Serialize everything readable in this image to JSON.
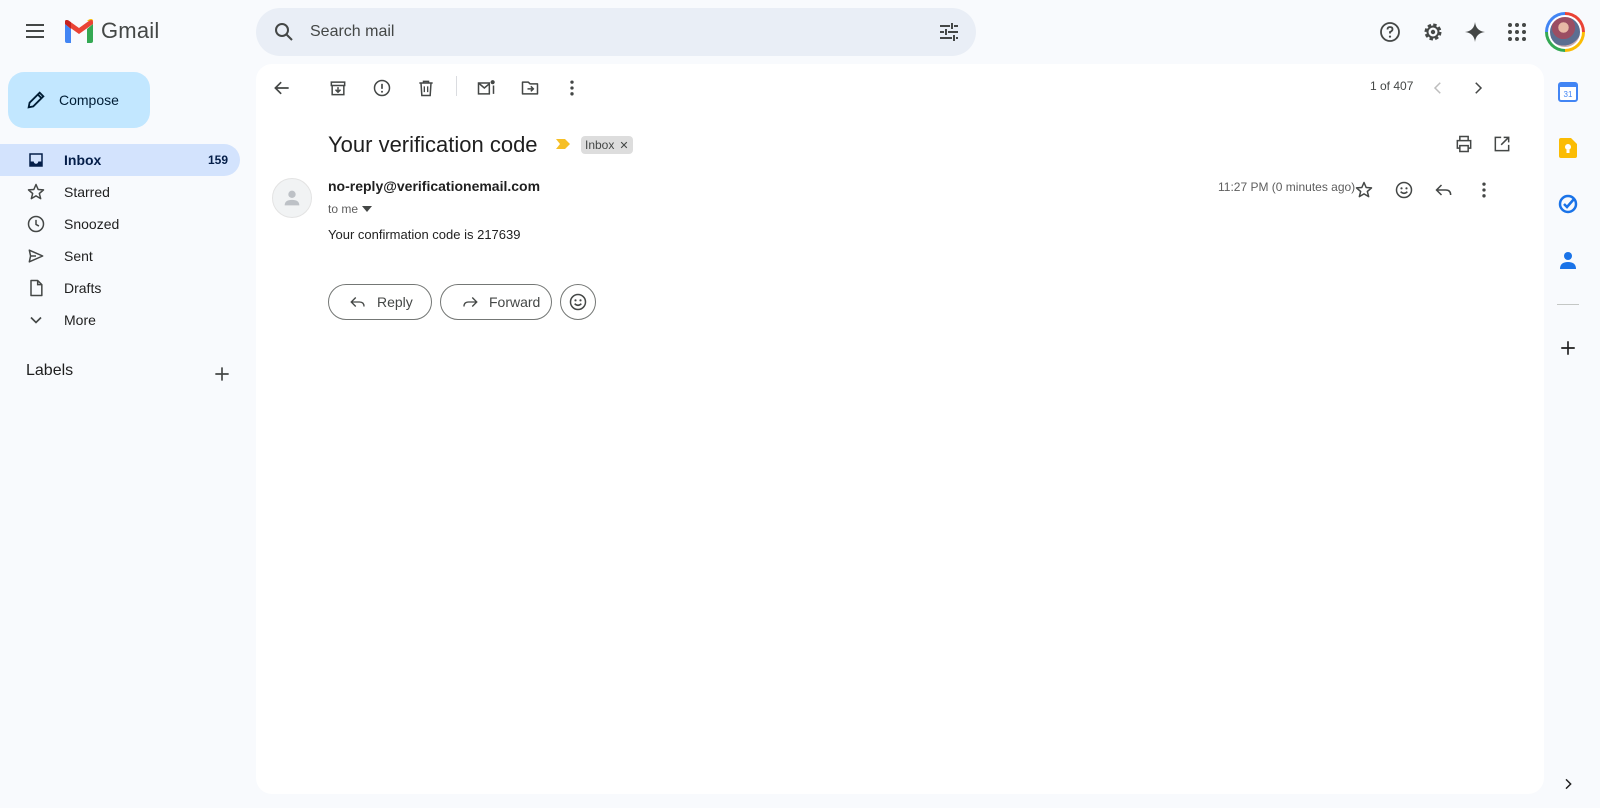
{
  "header": {
    "app_name": "Gmail",
    "search_placeholder": "Search mail"
  },
  "sidebar": {
    "compose_label": "Compose",
    "items": [
      {
        "label": "Inbox",
        "count": "159",
        "icon": "inbox-icon",
        "active": true
      },
      {
        "label": "Starred",
        "count": "",
        "icon": "star-icon"
      },
      {
        "label": "Snoozed",
        "count": "",
        "icon": "clock-icon"
      },
      {
        "label": "Sent",
        "count": "",
        "icon": "send-icon"
      },
      {
        "label": "Drafts",
        "count": "",
        "icon": "draft-icon"
      },
      {
        "label": "More",
        "count": "",
        "icon": "chevron-down-icon"
      }
    ],
    "labels_title": "Labels"
  },
  "toolbar": {
    "counter": "1 of 407"
  },
  "message": {
    "subject": "Your verification code",
    "label_chip": "Inbox",
    "sender": "no-reply@verificationemail.com",
    "recipient": "to me",
    "timestamp": "11:27 PM (0 minutes ago)",
    "body": "Your confirmation code is 217639",
    "reply_label": "Reply",
    "forward_label": "Forward"
  },
  "colors": {
    "compose_bg": "#c2e7ff",
    "active_nav_bg": "#d3e3fd",
    "page_bg": "#f8fafd",
    "importance_marker": "#f6bf26"
  }
}
